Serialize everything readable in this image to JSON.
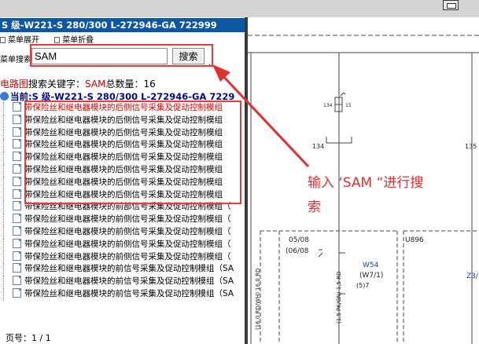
{
  "window": {
    "title": "S 级-W221-S 280/300 L-272946-GA 722999"
  },
  "menu": {
    "expand_label": "菜单展开",
    "collapse_label": "菜单折叠"
  },
  "search": {
    "label": "菜单搜索",
    "value": "SAM",
    "button_label": "搜索",
    "dot": "."
  },
  "result": {
    "prefix": "电路图",
    "middle": "搜索关键字：",
    "keyword": "SAM",
    "count_label": "总数量：",
    "count": "16"
  },
  "current": {
    "label": "当前:S 级-W221-S 280/300 L-272946-GA 7229"
  },
  "items": [
    {
      "label": "带保险丝和继电器模块的后侧信号采集及促动控制模组"
    },
    {
      "label": "带保险丝和继电器模块的后侧信号采集及促动控制模组"
    },
    {
      "label": "带保险丝和继电器模块的后侧信号采集及促动控制模组"
    },
    {
      "label": "带保险丝和继电器模块的后侧信号采集及促动控制模组"
    },
    {
      "label": "带保险丝和继电器模块的后侧信号采集及促动控制模组"
    },
    {
      "label": "带保险丝和继电器模块的后侧信号采集及促动控制模组"
    },
    {
      "label": "带保险丝和继电器模块的后侧信号采集及促动控制模组"
    },
    {
      "label": "带保险丝和继电器模块的后侧信号采集及促动控制模组"
    },
    {
      "label": "带保险丝和继电器模块的前部信号采集及促动控制模组（"
    },
    {
      "label": "带保险丝和继电器模块的前侧信号采集及促动控制模组（"
    },
    {
      "label": "带保险丝和继电器模块的前侧信号采集及促动控制模组（"
    },
    {
      "label": "带保险丝和继电器模块的前侧信号采集及促动控制模组（"
    },
    {
      "label": "带保险丝和继电器模块的前侧信号采集及促动控制模组（"
    },
    {
      "label": "带保险丝和继电器模块的前信号采集及促动控制模组（SA"
    },
    {
      "label": "带保险丝和继电器模块的前信号采集及促动控制模组（SA"
    },
    {
      "label": "带保险丝和继电器模块的前信号采集及促动控制模组（SA"
    }
  ],
  "pager": {
    "label": "页号：",
    "value": "1 / 1"
  },
  "schematic": {
    "labels": {
      "n134_small": "134",
      "n15_small": "15",
      "n134": "134",
      "n135": "135",
      "c0508": "05/08",
      "c0608": "(06/08",
      "u896": "U896",
      "w54": "W54",
      "w71": "(W7/1)",
      "p57": "(5)7",
      "z3": "Z3/",
      "wire1": "(16.0 RD/WH) 16.0 RD",
      "wire2": "(1.5 PK/GN) 1.5 RD"
    }
  },
  "annotation": {
    "line1": "输入 ‘SAM “进行搜",
    "line2": "索"
  },
  "colors": {
    "accent_blue": "#0b57a4",
    "highlight_red": "#ea3a3a",
    "text_red": "#d40000",
    "link_blue": "#000a8c"
  }
}
